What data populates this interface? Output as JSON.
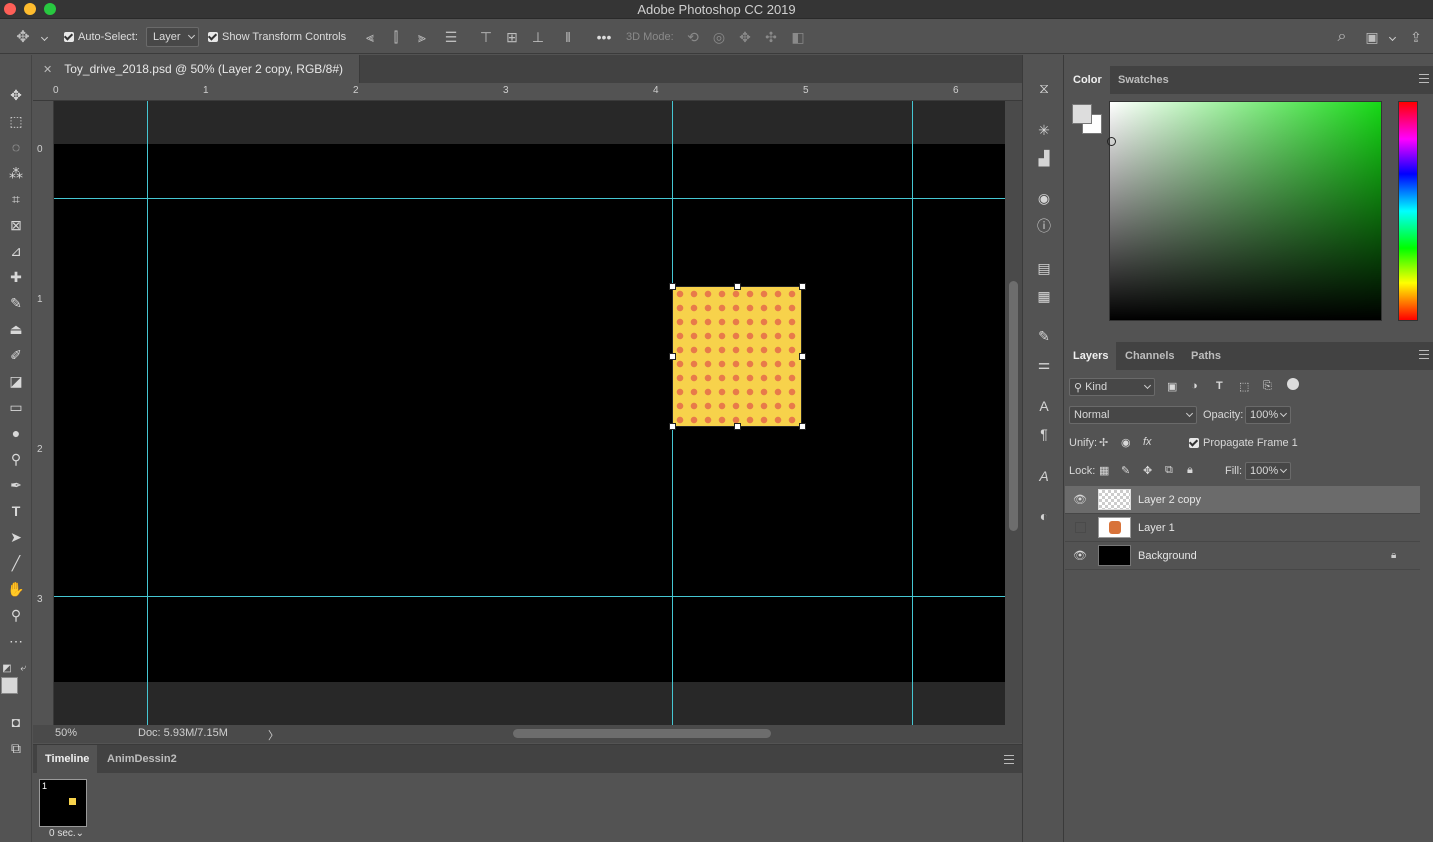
{
  "window": {
    "title": "Adobe Photoshop CC 2019",
    "traffic_colors": [
      "#fe5f57",
      "#febc2e",
      "#28c840"
    ]
  },
  "options_bar": {
    "auto_select_label": "Auto-Select:",
    "auto_select_value": "Layer",
    "show_transform_label": "Show Transform Controls",
    "more_glyph": "•••",
    "mode_3d_label": "3D Mode:"
  },
  "document": {
    "tab_title": "Toy_drive_2018.psd @ 50% (Layer 2 copy, RGB/8#)",
    "close_glyph": "✕",
    "h_ruler_labels": [
      "0",
      "1",
      "2",
      "3",
      "4",
      "5",
      "6"
    ],
    "v_ruler_labels": [
      "0",
      "1",
      "2",
      "3"
    ]
  },
  "status": {
    "zoom": "50%",
    "doc_size": "Doc: 5.93M/7.15M",
    "arrow": "〉"
  },
  "timeline": {
    "tabs": [
      "Timeline",
      "AnimDessin2"
    ],
    "frame_number": "1",
    "frame_delay": "0 sec.⌄"
  },
  "color_panel": {
    "tabs": [
      "Color",
      "Swatches"
    ]
  },
  "layers_panel": {
    "tabs": [
      "Layers",
      "Channels",
      "Paths"
    ],
    "filter_label": "Kind",
    "blend_mode": "Normal",
    "opacity_label": "Opacity:",
    "opacity_value": "100%",
    "unify_label": "Unify:",
    "propagate_label": "Propagate Frame 1",
    "lock_label": "Lock:",
    "fill_label": "Fill:",
    "fill_value": "100%",
    "layers": [
      {
        "name": "Layer 2 copy",
        "visible": true,
        "selected": true
      },
      {
        "name": "Layer 1",
        "visible": false,
        "selected": false
      },
      {
        "name": "Background",
        "visible": true,
        "selected": false,
        "locked": true
      }
    ]
  }
}
